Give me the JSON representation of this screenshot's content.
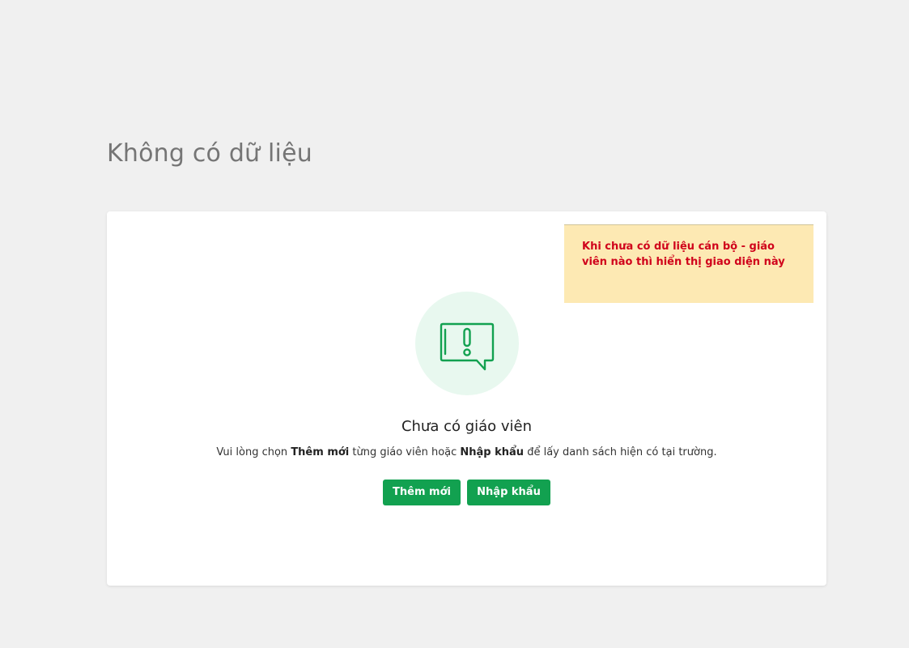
{
  "page": {
    "title": "Không có dữ liệu"
  },
  "note": {
    "text": "Khi chưa có dữ liệu cán bộ - giáo viên nào thì hiển thị giao diện này"
  },
  "empty_state": {
    "icon": "message-alert-icon",
    "title": "Chưa có giáo viên",
    "desc_part1": "Vui lòng chọn ",
    "desc_bold1": "Thêm mới",
    "desc_part2": " từng giáo viên hoặc ",
    "desc_bold2": "Nhập khẩu",
    "desc_part3": " để lấy danh sách hiện có tại trường."
  },
  "buttons": {
    "add_label": "Thêm mới",
    "import_label": "Nhập khẩu"
  },
  "colors": {
    "accent": "#12a150",
    "icon_bg": "#e8f8ef",
    "note_bg": "#fde9b3",
    "note_text": "#d0021b"
  }
}
